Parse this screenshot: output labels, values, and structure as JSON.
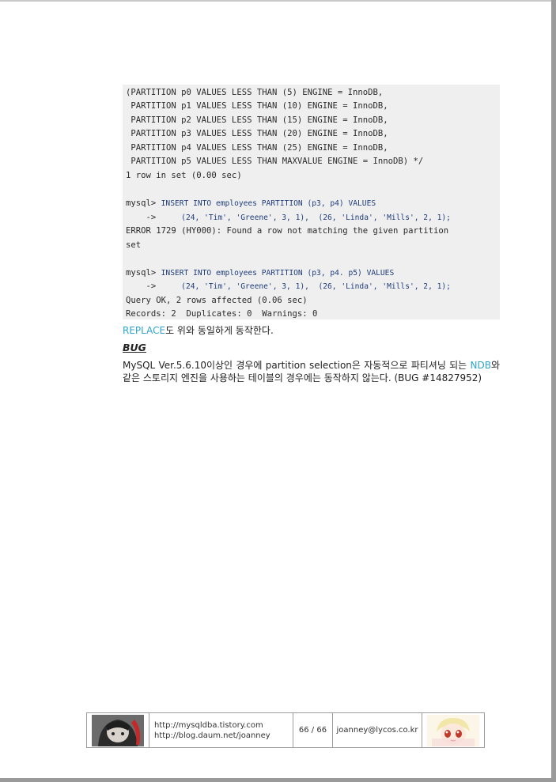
{
  "code": {
    "lines": [
      "(PARTITION p0 VALUES LESS THAN (5) ENGINE = InnoDB,",
      " PARTITION p1 VALUES LESS THAN (10) ENGINE = InnoDB,",
      " PARTITION p2 VALUES LESS THAN (15) ENGINE = InnoDB,",
      " PARTITION p3 VALUES LESS THAN (20) ENGINE = InnoDB,",
      " PARTITION p4 VALUES LESS THAN (25) ENGINE = InnoDB,",
      " PARTITION p5 VALUES LESS THAN MAXVALUE ENGINE = InnoDB) */",
      "1 row in set (0.00 sec)"
    ],
    "prompt": "mysql> ",
    "insert1": "INSERT INTO employees PARTITION (p3, p4) VALUES",
    "arrow": "    ->     ",
    "values1": "(24, 'Tim', 'Greene', 3, 1),  (26, 'Linda', 'Mills', 2, 1);",
    "error_line1": "ERROR 1729 (HY000): Found a row not matching the given partition",
    "error_line2": "set",
    "insert2": "INSERT INTO employees PARTITION (p3, p4. p5) VALUES",
    "values2": "(24, 'Tim', 'Greene', 3, 1),  (26, 'Linda', 'Mills', 2, 1);",
    "ok_line": "Query OK, 2 rows affected (0.06 sec)",
    "records_line": "Records: 2  Duplicates: 0  Warnings: 0"
  },
  "text": {
    "replace_link": "REPLACE",
    "replace_rest": "도 위와 동일하게 동작한다.",
    "bug_heading": "BUG",
    "bug_part1": "MySQL Ver.5.6.10이상인 경우에 partition selection은 자동적으로 파티셔닝 되는 ",
    "bug_link": "NDB",
    "bug_part2": "와 같은 스토리지 엔진을 사용하는 테이블의 경우에는 동작하지 않는다. (BUG #14827952)"
  },
  "footer": {
    "url1": "http://mysqldba.tistory.com",
    "url2": "http://blog.daum.net/joanney",
    "page": "66 / 66",
    "email": "joanney@lycos.co.kr"
  },
  "colors": {
    "code_bg": "#efefef",
    "sql_blue": "#1f3d7a",
    "link_blue": "#2fa4c9"
  }
}
